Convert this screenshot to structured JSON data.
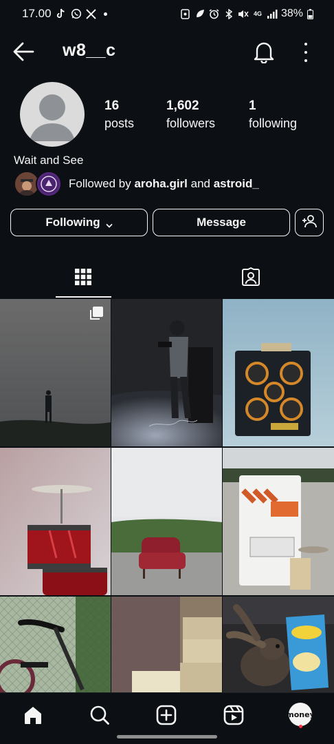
{
  "status_bar": {
    "time": "17.00",
    "battery": "38%",
    "network": "4G",
    "left_icons": [
      "tiktok-icon",
      "whatsapp-icon",
      "x-icon"
    ],
    "right_icons": [
      "screen-record-icon",
      "leaf-icon",
      "alarm-icon",
      "bluetooth-icon",
      "mute-icon",
      "network-icon",
      "signal-icon",
      "battery-icon"
    ]
  },
  "header": {
    "username": "w8__c"
  },
  "profile": {
    "stats": [
      {
        "value": "16",
        "label": "posts"
      },
      {
        "value": "1,602",
        "label": "followers"
      },
      {
        "value": "1",
        "label": "following"
      }
    ],
    "bio": "Wait and See",
    "followed_by": {
      "prefix": "Followed by ",
      "user1": "aroha.girl",
      "joiner": " and ",
      "user2": "astroid_"
    }
  },
  "actions": {
    "following_label": "Following",
    "message_label": "Message"
  },
  "tabs": [
    {
      "name": "posts-grid",
      "active": true
    },
    {
      "name": "tagged",
      "active": false
    }
  ],
  "grid": {
    "posts": [
      {
        "subject": "silhouette on hill under overcast sky",
        "multi": true
      },
      {
        "subject": "photographer in studio"
      },
      {
        "subject": "bass amplifier on pale blue"
      },
      {
        "subject": "red drum with cymbal"
      },
      {
        "subject": "red armchair in field"
      },
      {
        "subject": "road barricade street services"
      },
      {
        "subject": "bicycle by fence"
      },
      {
        "subject": "stacked boxes"
      },
      {
        "subject": "rabbit with chips bag"
      }
    ]
  },
  "nav": {
    "items": [
      "home-icon",
      "search-icon",
      "create-icon",
      "reels-icon",
      "profile-avatar"
    ],
    "profile_text": "money"
  },
  "colors": {
    "background": "#0c1014",
    "text": "#f5f5f5",
    "notification": "#ff3040"
  }
}
